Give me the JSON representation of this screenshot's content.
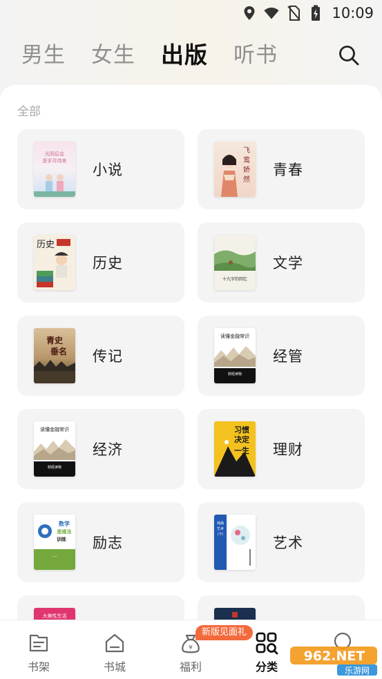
{
  "status_bar": {
    "time": "10:09"
  },
  "header": {
    "tabs": [
      {
        "label": "男生",
        "active": false
      },
      {
        "label": "女生",
        "active": false
      },
      {
        "label": "出版",
        "active": true
      },
      {
        "label": "听书",
        "active": false
      }
    ],
    "search_icon": "search-icon"
  },
  "main": {
    "section_label": "全部",
    "categories": [
      {
        "label": "小说",
        "cover_text": "光阴后会，是岁月待来",
        "colors": [
          "#f8e3ec",
          "#cfe3f2"
        ]
      },
      {
        "label": "青春",
        "cover_text": "飞鸾娇然",
        "colors": [
          "#f5e8dc",
          "#e9b7a0"
        ]
      },
      {
        "label": "历史",
        "cover_text": "历史",
        "colors": [
          "#f6eee0",
          "#4d9c5a"
        ]
      },
      {
        "label": "文学",
        "cover_text": "十九字的回忆",
        "colors": [
          "#9fc48a",
          "#f4f1e8"
        ]
      },
      {
        "label": "传记",
        "cover_text": "青史垂名",
        "colors": [
          "#c8a77a",
          "#2f2a22"
        ]
      },
      {
        "label": "经管",
        "cover_text": "读懂金融常识",
        "colors": [
          "#ffffff",
          "#111111"
        ]
      },
      {
        "label": "经济",
        "cover_text": "读懂金融常识",
        "colors": [
          "#ffffff",
          "#111111"
        ]
      },
      {
        "label": "理财",
        "cover_text": "习惯决定一生",
        "colors": [
          "#f3c21f",
          "#1a1a1a"
        ]
      },
      {
        "label": "励志",
        "cover_text": "数学思维法训练",
        "colors": [
          "#ffffff",
          "#74a83c"
        ]
      },
      {
        "label": "艺术",
        "cover_text": "戏曲艺术（下）",
        "colors": [
          "#2159b3",
          "#ffffff"
        ]
      },
      {
        "label": "",
        "cover_text": "大美性生活",
        "colors": [
          "#e0356f",
          "#f6f6f6"
        ]
      },
      {
        "label": "",
        "cover_text": "",
        "colors": [
          "#1b2f4e",
          "#f6f6f6"
        ]
      }
    ]
  },
  "bottom_nav": {
    "items": [
      {
        "label": "书架",
        "icon": "bookshelf-icon",
        "active": false
      },
      {
        "label": "书城",
        "icon": "store-icon",
        "active": false
      },
      {
        "label": "福利",
        "icon": "gift-bag-icon",
        "active": false
      },
      {
        "label": "分类",
        "icon": "category-icon",
        "active": true
      },
      {
        "label": "",
        "icon": "profile-icon",
        "active": false
      }
    ],
    "badge": "新版见面礼"
  },
  "watermark": {
    "text": "962.NET",
    "subtext": "乐游网"
  }
}
